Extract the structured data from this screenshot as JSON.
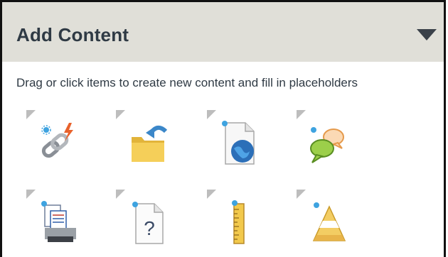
{
  "panel": {
    "title": "Add Content",
    "collapse_icon": "triangle-down-icon",
    "help_text": "Drag or click items to create new content and fill in placeholders"
  },
  "tools": [
    {
      "icon": "link-icon"
    },
    {
      "icon": "folder-import-icon"
    },
    {
      "icon": "web-page-icon"
    },
    {
      "icon": "discussion-icon"
    },
    {
      "icon": "printer-icon"
    },
    {
      "icon": "quiz-icon"
    },
    {
      "icon": "ruler-icon"
    },
    {
      "icon": "pyramid-icon"
    }
  ],
  "colors": {
    "header_bg": "#e0dfd8",
    "title_text": "#2f3a44",
    "new_badge": "#3ea3e0"
  }
}
